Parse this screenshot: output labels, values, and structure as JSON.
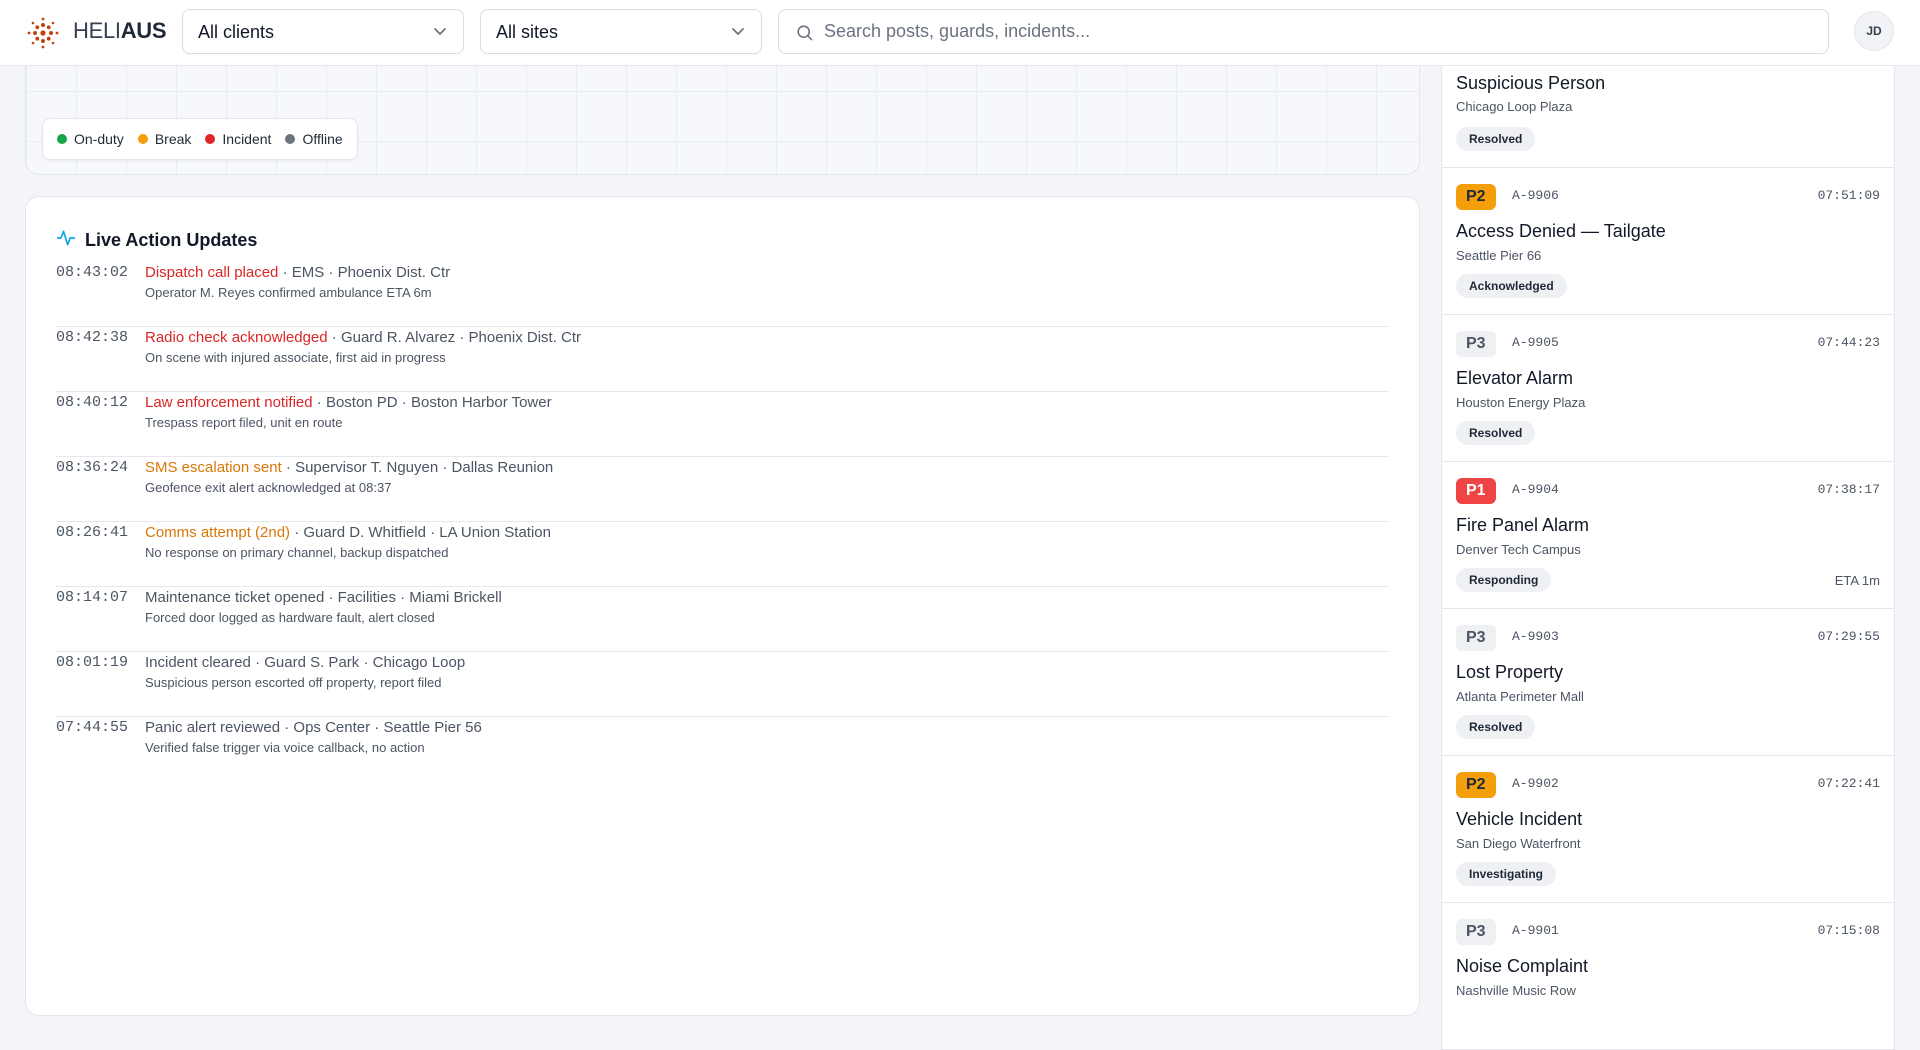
{
  "header": {
    "brand_light": "HELI",
    "brand_bold": "AUS",
    "clients_select": "All clients",
    "sites_select": "All sites",
    "search_placeholder": "Search posts, guards, incidents...",
    "avatar_initials": "JD"
  },
  "map": {
    "legend": [
      {
        "label": "On-duty",
        "color": "#16a34a"
      },
      {
        "label": "Break",
        "color": "#f59e0b"
      },
      {
        "label": "Incident",
        "color": "#dc2626"
      },
      {
        "label": "Offline",
        "color": "#6b7280"
      }
    ]
  },
  "live": {
    "title": "Live Action Updates",
    "updates": [
      {
        "time": "08:43:02",
        "action": "Dispatch call placed",
        "action_color": "#dc2626",
        "rest": " · EMS · Phoenix Dist. Ctr",
        "detail": "Operator M. Reyes confirmed ambulance ETA 6m"
      },
      {
        "time": "08:42:38",
        "action": "Radio check acknowledged",
        "action_color": "#dc2626",
        "rest": " · Guard R. Alvarez · Phoenix Dist. Ctr",
        "detail": "On scene with injured associate, first aid in progress"
      },
      {
        "time": "08:40:12",
        "action": "Law enforcement notified",
        "action_color": "#dc2626",
        "rest": " · Boston PD · Boston Harbor Tower",
        "detail": "Trespass report filed, unit en route"
      },
      {
        "time": "08:36:24",
        "action": "SMS escalation sent",
        "action_color": "#d97706",
        "rest": " · Supervisor T. Nguyen · Dallas Reunion",
        "detail": "Geofence exit alert acknowledged at 08:37"
      },
      {
        "time": "08:26:41",
        "action": "Comms attempt (2nd)",
        "action_color": "#d97706",
        "rest": " · Guard D. Whitfield · LA Union Station",
        "detail": "No response on primary channel, backup dispatched"
      },
      {
        "time": "08:14:07",
        "action": "Maintenance ticket opened",
        "action_color": "#4b5563",
        "rest": " · Facilities · Miami Brickell",
        "detail": "Forced door logged as hardware fault, alert closed"
      },
      {
        "time": "08:01:19",
        "action": "Incident cleared",
        "action_color": "#4b5563",
        "rest": " · Guard S. Park · Chicago Loop",
        "detail": "Suspicious person escorted off property, report filed"
      },
      {
        "time": "07:44:55",
        "action": "Panic alert reviewed",
        "action_color": "#4b5563",
        "rest": " · Ops Center · Seattle Pier 56",
        "detail": "Verified false trigger via voice callback, no action"
      }
    ]
  },
  "alerts": [
    {
      "priority": "",
      "id": "",
      "time": "",
      "title": "Suspicious Person",
      "site": "Chicago Loop Plaza",
      "status": "Resolved",
      "eta": "",
      "prio_bg": "#eef0f3",
      "prio_fg": "#4b5563"
    },
    {
      "priority": "P2",
      "id": "A-9906",
      "time": "07:51:09",
      "title": "Access Denied — Tailgate",
      "site": "Seattle Pier 66",
      "status": "Acknowledged",
      "eta": "",
      "prio_bg": "#f59e0b",
      "prio_fg": "#1f2937"
    },
    {
      "priority": "P3",
      "id": "A-9905",
      "time": "07:44:23",
      "title": "Elevator Alarm",
      "site": "Houston Energy Plaza",
      "status": "Resolved",
      "eta": "",
      "prio_bg": "#eef0f3",
      "prio_fg": "#4b5563"
    },
    {
      "priority": "P1",
      "id": "A-9904",
      "time": "07:38:17",
      "title": "Fire Panel Alarm",
      "site": "Denver Tech Campus",
      "status": "Responding",
      "eta": "ETA 1m",
      "prio_bg": "#ef4444",
      "prio_fg": "#ffffff"
    },
    {
      "priority": "P3",
      "id": "A-9903",
      "time": "07:29:55",
      "title": "Lost Property",
      "site": "Atlanta Perimeter Mall",
      "status": "Resolved",
      "eta": "",
      "prio_bg": "#eef0f3",
      "prio_fg": "#4b5563"
    },
    {
      "priority": "P2",
      "id": "A-9902",
      "time": "07:22:41",
      "title": "Vehicle Incident",
      "site": "San Diego Waterfront",
      "status": "Investigating",
      "eta": "",
      "prio_bg": "#f59e0b",
      "prio_fg": "#1f2937"
    },
    {
      "priority": "P3",
      "id": "A-9901",
      "time": "07:15:08",
      "title": "Noise Complaint",
      "site": "Nashville Music Row",
      "status": "",
      "eta": "",
      "prio_bg": "#eef0f3",
      "prio_fg": "#4b5563"
    }
  ]
}
